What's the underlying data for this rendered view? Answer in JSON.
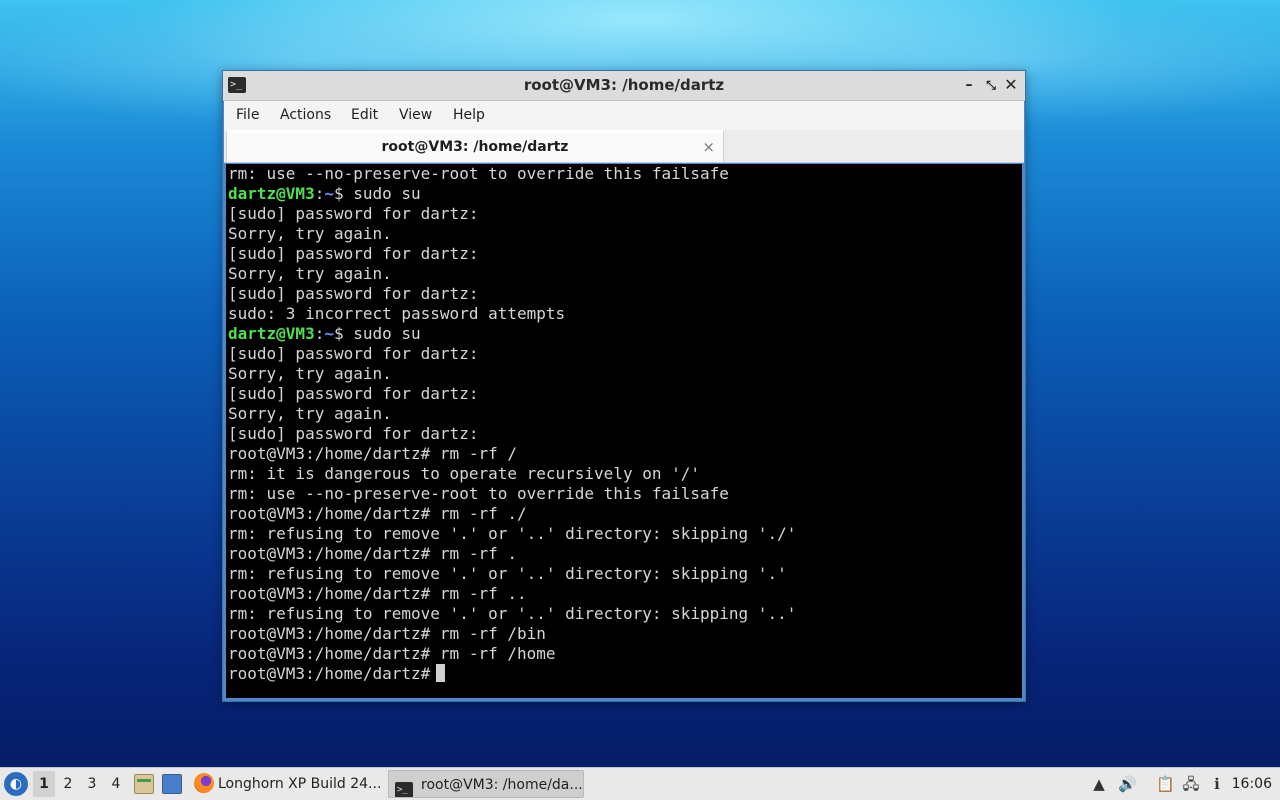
{
  "window": {
    "title": "root@VM3: /home/dartz",
    "controls": {
      "minimize": "–",
      "maximize": "⤡",
      "close": "✕"
    }
  },
  "menu": [
    "File",
    "Actions",
    "Edit",
    "View",
    "Help"
  ],
  "tab": {
    "label": "root@VM3: /home/dartz",
    "close": "×"
  },
  "terminal": {
    "lines": [
      {
        "out": "rm: use --no-preserve-root to override this failsafe"
      },
      {
        "user": "dartz@VM3",
        "path": "~",
        "sym": "$ ",
        "cmd": "sudo su"
      },
      {
        "out": "[sudo] password for dartz: "
      },
      {
        "out": "Sorry, try again."
      },
      {
        "out": "[sudo] password for dartz: "
      },
      {
        "out": "Sorry, try again."
      },
      {
        "out": "[sudo] password for dartz: "
      },
      {
        "out": "sudo: 3 incorrect password attempts"
      },
      {
        "user": "dartz@VM3",
        "path": "~",
        "sym": "$ ",
        "cmd": "sudo su"
      },
      {
        "out": "[sudo] password for dartz: "
      },
      {
        "out": "Sorry, try again."
      },
      {
        "out": "[sudo] password for dartz: "
      },
      {
        "out": "Sorry, try again."
      },
      {
        "out": "[sudo] password for dartz: "
      },
      {
        "out": "root@VM3:/home/dartz# rm -rf /"
      },
      {
        "out": "rm: it is dangerous to operate recursively on '/'"
      },
      {
        "out": "rm: use --no-preserve-root to override this failsafe"
      },
      {
        "out": "root@VM3:/home/dartz# rm -rf ./"
      },
      {
        "out": "rm: refusing to remove '.' or '..' directory: skipping './'"
      },
      {
        "out": "root@VM3:/home/dartz# rm -rf ."
      },
      {
        "out": "rm: refusing to remove '.' or '..' directory: skipping '.'"
      },
      {
        "out": "root@VM3:/home/dartz# rm -rf .."
      },
      {
        "out": "rm: refusing to remove '.' or '..' directory: skipping '..'"
      },
      {
        "out": "root@VM3:/home/dartz# rm -rf /bin"
      },
      {
        "out": "root@VM3:/home/dartz# rm -rf /home"
      },
      {
        "out": "root@VM3:/home/dartz#",
        "cursor": true
      }
    ]
  },
  "taskbar": {
    "start_icon": "start-menu-icon",
    "workspaces": [
      "1",
      "2",
      "3",
      "4"
    ],
    "active_workspace": "1",
    "tasks": [
      {
        "label": "Longhorn XP Build 24...",
        "icon": "firefox-icon"
      },
      {
        "label": "root@VM3: /home/da...",
        "icon": "terminal-icon"
      }
    ],
    "clock": "16:06"
  }
}
